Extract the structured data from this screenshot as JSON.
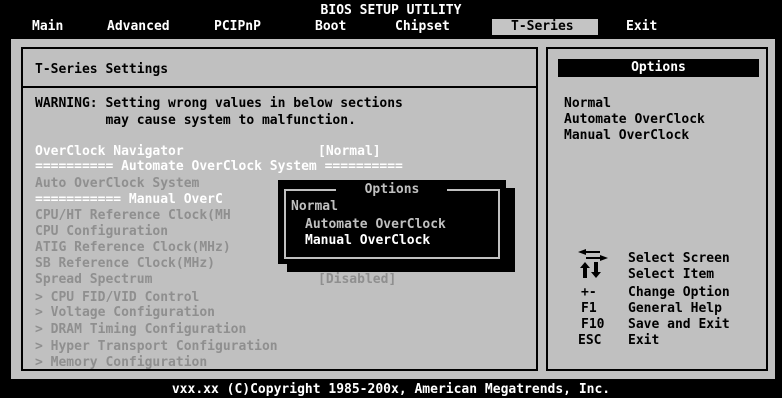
{
  "title": "BIOS SETUP UTILITY",
  "menu": [
    "Main",
    "Advanced",
    "PCIPnP",
    "Boot",
    "Chipset",
    "T-Series",
    "Exit"
  ],
  "selected_menu": "T-Series",
  "panel_title": "T-Series Settings",
  "warning": [
    "WARNING: Setting wrong values in below sections",
    "         may cause system to malfunction."
  ],
  "items": [
    {
      "label": "OverClock Navigator",
      "value": "[Normal]"
    },
    {
      "label": "========== Automate OverClock System ==========",
      "value": ""
    },
    {
      "label": "Auto OverClock System",
      "value": ""
    },
    {
      "label": "=========== Manual OverC",
      "value": ""
    },
    {
      "label": "CPU/HT Reference Clock(MH",
      "value": ""
    },
    {
      "label": "CPU Configuration",
      "value": ""
    },
    {
      "label": "ATIG Reference Clock(MHz)",
      "value": ""
    },
    {
      "label": "SB Reference Clock(MHz)",
      "value": ""
    },
    {
      "label": "Spread Spectrum",
      "value": "[Disabled]"
    },
    {
      "label": "> CPU FID/VID Control",
      "value": ""
    },
    {
      "label": "> Voltage Configuration",
      "value": ""
    },
    {
      "label": "> DRAM Timing Configuration",
      "value": ""
    },
    {
      "label": "> Hyper Transport Configuration",
      "value": ""
    },
    {
      "label": "> Memory Configuration",
      "value": ""
    }
  ],
  "popup": {
    "title": "Options",
    "options": [
      "Normal",
      "Automate OverClock",
      "Manual OverClock"
    ],
    "selected": "Manual OverClock"
  },
  "help": {
    "header": "Options",
    "lines": [
      "Normal",
      "Automate OverClock",
      "Manual OverClock"
    ]
  },
  "keys": [
    {
      "key": "",
      "desc": "Select Screen",
      "icon": "left-right-arrows-icon"
    },
    {
      "key": "",
      "desc": "Select Item",
      "icon": "up-down-arrows-icon"
    },
    {
      "key": "+-",
      "desc": "Change Option"
    },
    {
      "key": "F1",
      "desc": "General Help"
    },
    {
      "key": "F10",
      "desc": "Save and Exit"
    },
    {
      "key": "ESC",
      "desc": "Exit"
    }
  ],
  "footer": "vxx.xx (C)Copyright 1985-200x, American Megatrends, Inc."
}
